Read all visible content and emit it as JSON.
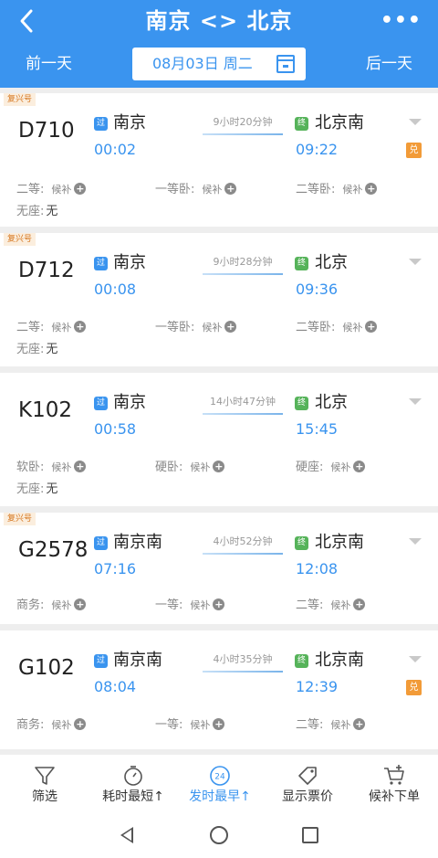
{
  "header": {
    "back_icon": "back-arrow-icon",
    "title": "南京 <> 北京",
    "more_label": "•••",
    "prev_day": "前一天",
    "next_day": "后一天",
    "date": "08月03日 周二",
    "calendar_icon": "calendar-icon",
    "bg_color": "#3a94ef"
  },
  "trains": [
    {
      "badge": "复兴号",
      "number": "D710",
      "from_tag": "过",
      "from": "南京",
      "dep": "00:02",
      "duration": "9小时20分钟",
      "to_tag": "终",
      "to": "北京南",
      "arr": "09:22",
      "exchange": "兑",
      "seats": [
        {
          "label": "二等:",
          "value": "候补"
        },
        {
          "label": "一等卧:",
          "value": "候补"
        },
        {
          "label": "二等卧:",
          "value": "候补"
        },
        {
          "label": "无座:",
          "value": "无"
        }
      ]
    },
    {
      "badge": "复兴号",
      "number": "D712",
      "from_tag": "过",
      "from": "南京",
      "dep": "00:08",
      "duration": "9小时28分钟",
      "to_tag": "终",
      "to": "北京",
      "arr": "09:36",
      "seats": [
        {
          "label": "二等:",
          "value": "候补"
        },
        {
          "label": "一等卧:",
          "value": "候补"
        },
        {
          "label": "二等卧:",
          "value": "候补"
        },
        {
          "label": "无座:",
          "value": "无"
        }
      ]
    },
    {
      "number": "K102",
      "from_tag": "过",
      "from": "南京",
      "dep": "00:58",
      "duration": "14小时47分钟",
      "to_tag": "终",
      "to": "北京",
      "arr": "15:45",
      "seats": [
        {
          "label": "软卧:",
          "value": "候补"
        },
        {
          "label": "硬卧:",
          "value": "候补"
        },
        {
          "label": "硬座:",
          "value": "候补"
        },
        {
          "label": "无座:",
          "value": "无"
        }
      ]
    },
    {
      "badge": "复兴号",
      "number": "G2578",
      "from_tag": "过",
      "from": "南京南",
      "dep": "07:16",
      "duration": "4小时52分钟",
      "to_tag": "终",
      "to": "北京南",
      "arr": "12:08",
      "seats": [
        {
          "label": "商务:",
          "value": "候补"
        },
        {
          "label": "一等:",
          "value": "候补"
        },
        {
          "label": "二等:",
          "value": "候补"
        }
      ]
    },
    {
      "number": "G102",
      "from_tag": "过",
      "from": "南京南",
      "dep": "08:04",
      "duration": "4小时35分钟",
      "to_tag": "终",
      "to": "北京南",
      "arr": "12:39",
      "exchange": "兑",
      "seats": [
        {
          "label": "商务:",
          "value": "候补"
        },
        {
          "label": "一等:",
          "value": "候补"
        },
        {
          "label": "二等:",
          "value": "候补"
        }
      ]
    }
  ],
  "toolbar": {
    "filter": "筛选",
    "shortest": "耗时最短↑",
    "earliest": "发时最早↑",
    "earliest_icon_text": "24",
    "show_price": "显示票价",
    "waitlist": "候补下单",
    "active_color": "#3a94ef"
  },
  "sysnav": {
    "back_icon": "nav-back-icon",
    "home_icon": "nav-home-icon",
    "recent_icon": "nav-recent-icon"
  }
}
